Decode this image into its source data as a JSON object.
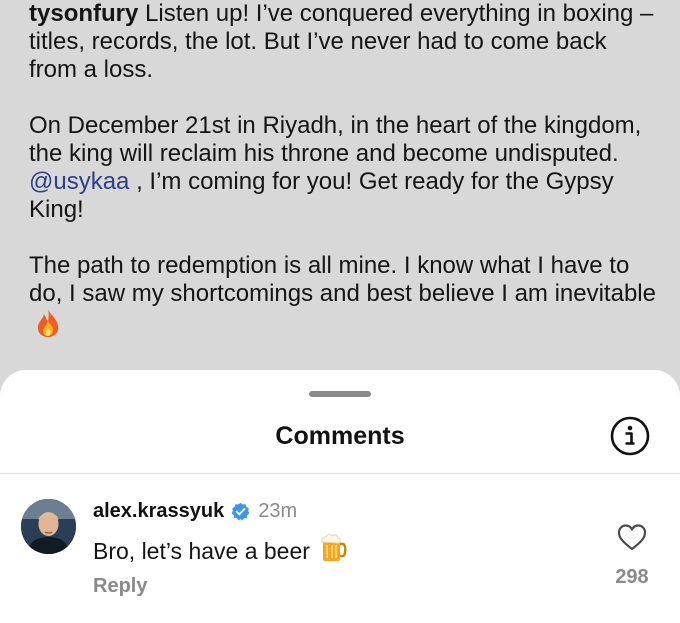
{
  "caption": {
    "username": "tysonfury",
    "paragraph1": "Listen up! I’ve conquered everything in boxing – titles, records, the lot. But I’ve never had to come back from a loss.",
    "paragraph2_before": "On December 21st in Riyadh, in the heart of the kingdom, the king will reclaim his throne and become undisputed.",
    "mention": "@usykaa",
    "paragraph2_after": ", I’m coming for you! Get ready for the Gypsy King!",
    "paragraph3": "The path to redemption is all mine. I know what I have to do, I saw my shortcomings and best believe I am inevitable"
  },
  "sheet": {
    "title": "Comments"
  },
  "comments": [
    {
      "username": "alex.krassyuk",
      "verified": true,
      "time": "23m",
      "text": "Bro, let’s have a beer",
      "reply_label": "Reply",
      "likes": "298"
    }
  ],
  "colors": {
    "overlay_background": "#d8d8d8",
    "mention": "#2c3f87",
    "verified_badge": "#3897f0",
    "secondary_text": "#8a8a8a"
  },
  "icons": {
    "info": "info-circle-icon",
    "like": "heart-outline-icon",
    "verified": "verified-badge-icon",
    "fire": "fire-emoji-icon",
    "beer": "beer-mug-emoji-icon"
  }
}
